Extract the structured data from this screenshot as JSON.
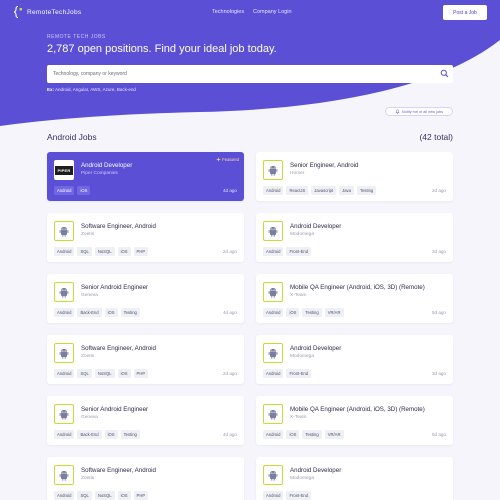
{
  "header": {
    "logo_text": "RemoteTechJobs",
    "nav": [
      "Technologies",
      "Company Login"
    ],
    "post_button": "Post a Job"
  },
  "hero": {
    "eyebrow": "REMOTE TECH JOBS",
    "headline": "2,787 open positions. Find your ideal job today.",
    "search_placeholder": "Technology, company or keyword",
    "examples_label": "Ex:",
    "examples": "Android, Angular, AWS, Azure, Back-end"
  },
  "notify_label": "Notify me of all new jobs",
  "section": {
    "title": "Android Jobs",
    "total": "(42 total)"
  },
  "colors": {
    "brand": "#5b4fd6",
    "logo_border": "#c6dc39",
    "featured_badge": "#ffd36b"
  },
  "jobs": [
    {
      "title": "Android Developer",
      "company": "Piper Companies",
      "tags": [
        "Android",
        "iOS"
      ],
      "ago": "4d ago",
      "featured": true,
      "badge": "Featured",
      "logo": "PIPER"
    },
    {
      "title": "Senior Engineer, Android",
      "company": "Homer",
      "tags": [
        "Android",
        "ReactJS",
        "Javascript",
        "Java",
        "Testing"
      ],
      "ago": "2d ago"
    },
    {
      "title": "Software Engineer, Android",
      "company": "Zoetis",
      "tags": [
        "Android",
        "SQL",
        "NoSQL",
        "iOS",
        "PHP"
      ],
      "ago": "2d ago"
    },
    {
      "title": "Android Developer",
      "company": "Modomega",
      "tags": [
        "Android",
        "Front-End"
      ],
      "ago": "3d ago"
    },
    {
      "title": "Senior Android Engineer",
      "company": "Geneva",
      "tags": [
        "Android",
        "Back-End",
        "iOS",
        "Testing"
      ],
      "ago": "4d ago"
    },
    {
      "title": "Mobile QA Engineer (Android, iOS, 3D) (Remote)",
      "company": "X-Team",
      "tags": [
        "Android",
        "iOS",
        "Testing",
        "VR/AR"
      ],
      "ago": "5d ago"
    },
    {
      "title": "Software Engineer, Android",
      "company": "Zoetis",
      "tags": [
        "Android",
        "SQL",
        "NoSQL",
        "iOS",
        "PHP"
      ],
      "ago": "2d ago"
    },
    {
      "title": "Android Developer",
      "company": "Modomega",
      "tags": [
        "Android",
        "Front-End"
      ],
      "ago": "3d ago"
    },
    {
      "title": "Senior Android Engineer",
      "company": "Geneva",
      "tags": [
        "Android",
        "Back-End",
        "iOS",
        "Testing"
      ],
      "ago": "4d ago"
    },
    {
      "title": "Mobile QA Engineer (Android, iOS, 3D) (Remote)",
      "company": "X-Team",
      "tags": [
        "Android",
        "iOS",
        "Testing",
        "VR/AR"
      ],
      "ago": "5d ago"
    },
    {
      "title": "Software Engineer, Android",
      "company": "Zoetis",
      "tags": [
        "Android",
        "SQL",
        "NoSQL",
        "iOS",
        "PHP"
      ],
      "ago": ""
    },
    {
      "title": "Android Developer",
      "company": "Modomega",
      "tags": [
        "Android",
        "Front-End"
      ],
      "ago": ""
    }
  ]
}
